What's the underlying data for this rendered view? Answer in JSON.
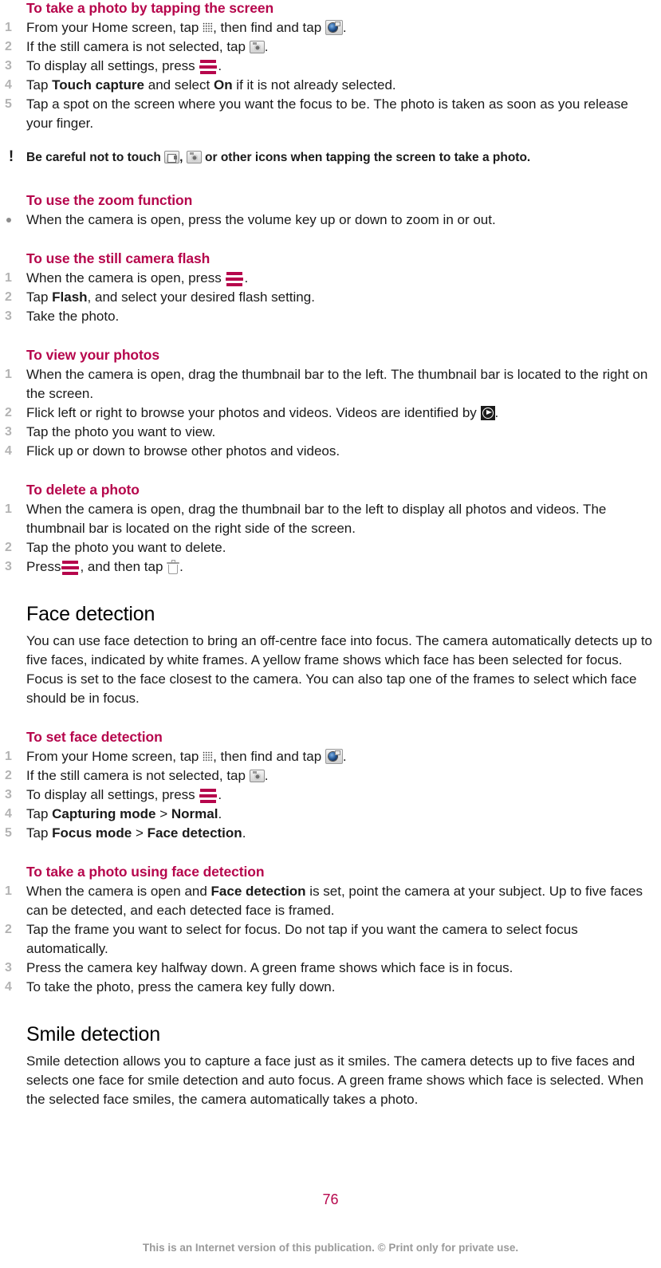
{
  "document": {
    "page_number": "76",
    "footer_note": "This is an Internet version of this publication. © Print only for private use."
  },
  "sections": [
    {
      "id": "take-photo-tapping",
      "heading": "To take a photo by tapping the screen",
      "steps": [
        {
          "num": "1",
          "text_before": "From your Home screen, tap ",
          "icon1": "app-grid-icon",
          "text_mid": ", then find and tap ",
          "icon2": "camera-app-icon",
          "text_after": "."
        },
        {
          "num": "2",
          "text_before": "If the still camera is not selected, tap ",
          "icon1": "still-camera-icon",
          "text_after": "."
        },
        {
          "num": "3",
          "text_before": "To display all settings, press ",
          "icon1": "menu-key-icon",
          "text_after": "."
        },
        {
          "num": "4",
          "text_before": "Tap ",
          "bold1": "Touch capture",
          "text_mid": " and select ",
          "bold2": "On",
          "text_after": " if it is not already selected."
        },
        {
          "num": "5",
          "text_before": "Tap a spot on the screen where you want the focus to be. The photo is taken as soon as you release your finger."
        }
      ]
    }
  ],
  "note": {
    "icon": "exclamation-icon",
    "bang": "!",
    "text_before": "Be careful not to touch ",
    "icon1": "video-camera-icon",
    "text_mid": ", ",
    "icon2": "still-camera-icon",
    "text_after": " or other icons when tapping the screen to take a photo."
  },
  "zoom_section": {
    "heading": "To use the zoom function",
    "bullet": "When the camera is open, press the volume key up or down to zoom in or out."
  },
  "flash_section": {
    "heading": "To use the still camera flash",
    "steps": [
      {
        "num": "1",
        "text_before": "When the camera is open, press ",
        "icon1": "menu-key-icon",
        "text_after": "."
      },
      {
        "num": "2",
        "text_before": "Tap ",
        "bold1": "Flash",
        "text_after": ", and select your desired flash setting."
      },
      {
        "num": "3",
        "text_before": "Take the photo."
      }
    ]
  },
  "view_photos_section": {
    "heading": "To view your photos",
    "steps": [
      {
        "num": "1",
        "text_before": "When the camera is open, drag the thumbnail bar to the left. The thumbnail bar is located to the right on the screen."
      },
      {
        "num": "2",
        "text_before": "Flick left or right to browse your photos and videos. Videos are identified by ",
        "icon1": "video-play-icon",
        "text_after": "."
      },
      {
        "num": "3",
        "text_before": "Tap the photo you want to view."
      },
      {
        "num": "4",
        "text_before": "Flick up or down to browse other photos and videos."
      }
    ]
  },
  "delete_photo_section": {
    "heading": "To delete a photo",
    "steps": [
      {
        "num": "1",
        "text_before": "When the camera is open, drag the thumbnail bar to the left to display all photos and videos. The thumbnail bar is located on the right side of the screen."
      },
      {
        "num": "2",
        "text_before": "Tap the photo you want to delete."
      },
      {
        "num": "3",
        "text_before": "Press",
        "icon1": "menu-key-icon",
        "text_mid": ", and then tap ",
        "icon2": "trash-icon",
        "text_after": "."
      }
    ]
  },
  "face_detection": {
    "heading": "Face detection",
    "paragraph": "You can use face detection to bring an off-centre face into focus. The camera automatically detects up to five faces, indicated by white frames. A yellow frame shows which face has been selected for focus. Focus is set to the face closest to the camera. You can also tap one of the frames to select which face should be in focus."
  },
  "set_face_detection": {
    "heading": "To set face detection",
    "steps": [
      {
        "num": "1",
        "text_before": "From your Home screen, tap ",
        "icon1": "app-grid-icon",
        "text_mid": ", then find and tap ",
        "icon2": "camera-app-icon",
        "text_after": "."
      },
      {
        "num": "2",
        "text_before": "If the still camera is not selected, tap ",
        "icon1": "still-camera-icon",
        "text_after": "."
      },
      {
        "num": "3",
        "text_before": "To display all settings, press ",
        "icon1": "menu-key-icon",
        "text_after": "."
      },
      {
        "num": "4",
        "text_before": "Tap ",
        "bold1": "Capturing mode",
        "text_mid": " > ",
        "bold2": "Normal",
        "text_after": "."
      },
      {
        "num": "5",
        "text_before": "Tap ",
        "bold1": "Focus mode",
        "text_mid": " > ",
        "bold2": "Face detection",
        "text_after": "."
      }
    ]
  },
  "take_photo_face_detection": {
    "heading": "To take a photo using face detection",
    "steps": [
      {
        "num": "1",
        "text_before": "When the camera is open and ",
        "bold1": "Face detection",
        "text_after": " is set, point the camera at your subject. Up to five faces can be detected, and each detected face is framed."
      },
      {
        "num": "2",
        "text_before": "Tap the frame you want to select for focus. Do not tap if you want the camera to select focus automatically."
      },
      {
        "num": "3",
        "text_before": "Press the camera key halfway down. A green frame shows which face is in focus."
      },
      {
        "num": "4",
        "text_before": "To take the photo, press the camera key fully down."
      }
    ]
  },
  "smile_detection": {
    "heading": "Smile detection",
    "paragraph": "Smile detection allows you to capture a face just as it smiles. The camera detects up to five faces and selects one face for smile detection and auto focus. A green frame shows which face is selected. When the selected face smiles, the camera automatically takes a photo."
  },
  "colors": {
    "heading_accent": "#b6064c",
    "body_text": "#1a1a1a",
    "step_number": "#b3b3b3",
    "footer_text": "#9a9a9a"
  }
}
